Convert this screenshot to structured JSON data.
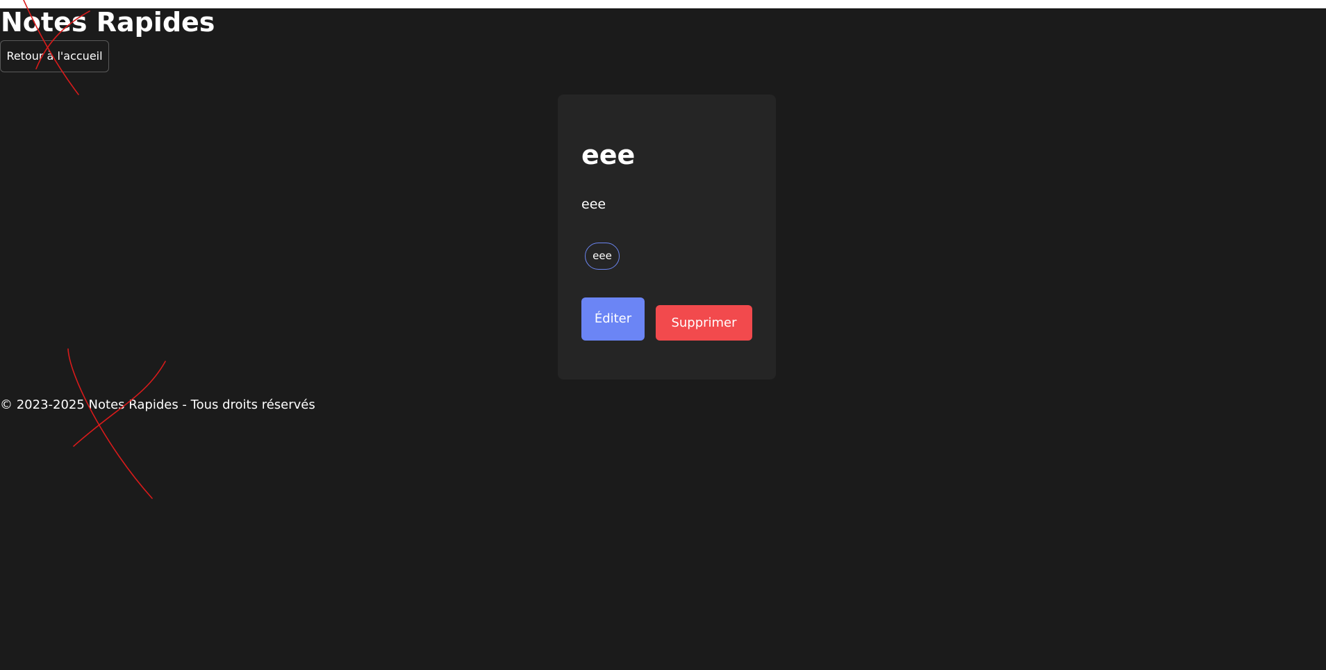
{
  "header": {
    "site_title": "Notes Rapides",
    "back_button_label": "Retour à l'accueil"
  },
  "note": {
    "title": "eee",
    "content": "eee",
    "tags": [
      "eee"
    ],
    "edit_label": "Éditer",
    "delete_label": "Supprimer"
  },
  "footer": {
    "copyright": "© 2023-2025 Notes Rapides - Tous droits réservés"
  },
  "colors": {
    "background": "#1b1b1b",
    "card_background": "#252525",
    "edit_button": "#6b85f5",
    "delete_button": "#f24a4d",
    "tag_border": "#6c86f2",
    "annotation_stroke": "#d81b1b"
  }
}
